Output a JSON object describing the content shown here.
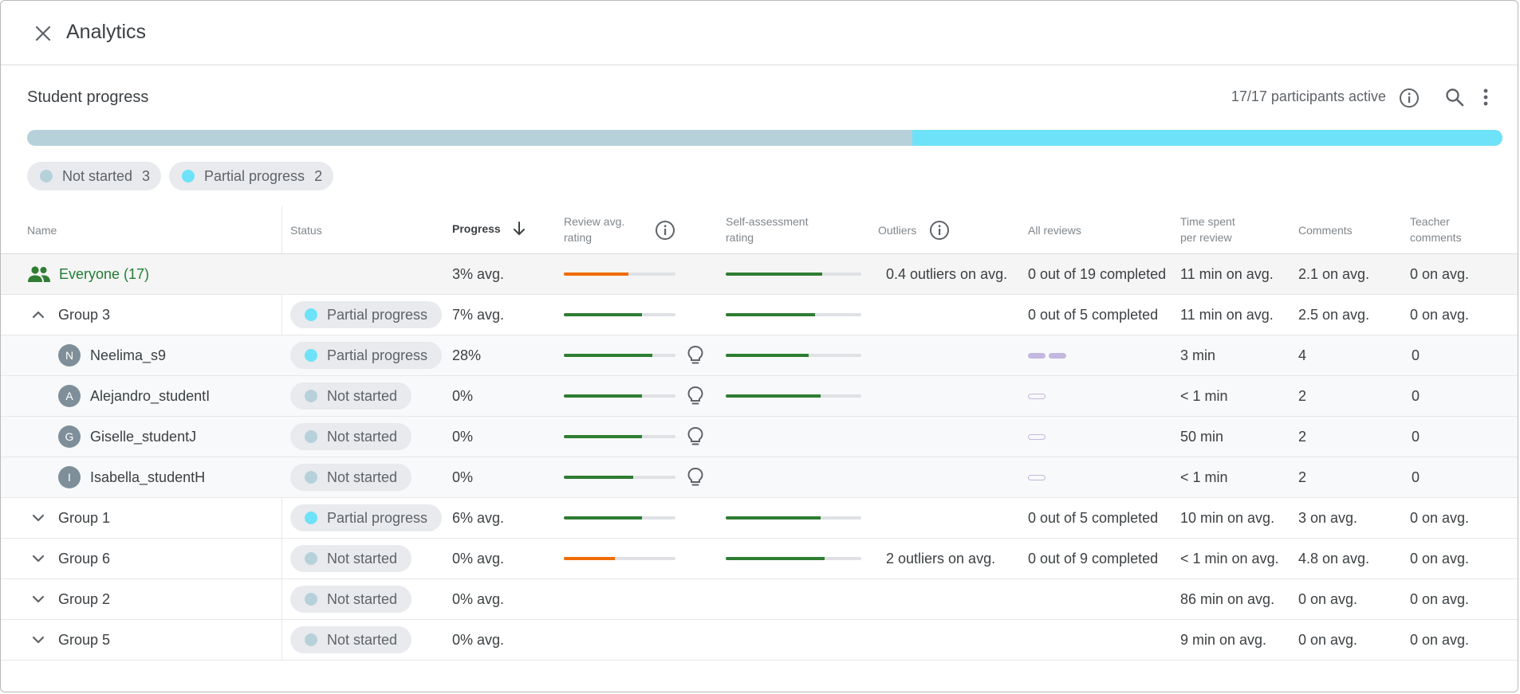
{
  "header": {
    "title": "Analytics"
  },
  "section": {
    "title": "Student progress",
    "participants": "17/17 participants active"
  },
  "overall_progress": {
    "not_started_fraction": 0.6,
    "partial_fraction": 0.4
  },
  "chips": [
    {
      "label": "Not started",
      "count": "3",
      "color": "#b7d1da"
    },
    {
      "label": "Partial progress",
      "count": "2",
      "color": "#6ee2f8"
    }
  ],
  "columns": {
    "name": "Name",
    "status": "Status",
    "progress": "Progress",
    "review_avg_1": "Review avg.",
    "review_avg_2": "rating",
    "self_1": "Self-assessment",
    "self_2": "rating",
    "outliers": "Outliers",
    "all_reviews": "All reviews",
    "time_1": "Time spent",
    "time_2": "per review",
    "comments": "Comments",
    "teacher_1": "Teacher",
    "teacher_2": "comments"
  },
  "colors": {
    "green": "#2e7d32",
    "orange": "#ef6c00",
    "not_started": "#b7d1da",
    "partial": "#6ee2f8"
  },
  "everyone": {
    "name": "Everyone (17)",
    "progress": "3% avg.",
    "review_rating": 0.58,
    "review_color": "orange",
    "self_rating": 0.71,
    "outliers": "0.4 outliers on avg.",
    "all_reviews": "0 out of 19 completed",
    "time": "11 min on avg.",
    "comments": "2.1 on avg.",
    "teacher": "0 on avg."
  },
  "rows": [
    {
      "kind": "group",
      "expanded": true,
      "name": "Group 3",
      "status": "Partial progress",
      "status_key": "partial",
      "progress": "7% avg.",
      "review_rating": 0.7,
      "review_color": "green",
      "self_rating": 0.66,
      "outliers": "",
      "all_reviews": "0 out of 5 completed",
      "time": "11 min on avg.",
      "comments": "2.5 on avg.",
      "teacher": "0 on avg."
    },
    {
      "kind": "student",
      "initial": "N",
      "name": "Neelima_s9",
      "status": "Partial progress",
      "status_key": "partial",
      "progress": "28%",
      "review_rating": 0.79,
      "review_color": "green",
      "bulb": true,
      "self_rating": 0.61,
      "outliers": "",
      "reviews_done": 2,
      "reviews_total": 2,
      "time": "3 min",
      "comments": "4",
      "teacher": "0"
    },
    {
      "kind": "student",
      "initial": "A",
      "name": "Alejandro_studentI",
      "status": "Not started",
      "status_key": "not_started",
      "progress": "0%",
      "review_rating": 0.7,
      "review_color": "green",
      "bulb": true,
      "self_rating": 0.7,
      "outliers": "",
      "reviews_done": 0,
      "reviews_total": 1,
      "time": "< 1 min",
      "comments": "2",
      "teacher": "0"
    },
    {
      "kind": "student",
      "initial": "G",
      "name": "Giselle_studentJ",
      "status": "Not started",
      "status_key": "not_started",
      "progress": "0%",
      "review_rating": 0.7,
      "review_color": "green",
      "bulb": true,
      "self_rating": null,
      "outliers": "",
      "reviews_done": 0,
      "reviews_total": 1,
      "time": "50 min",
      "comments": "2",
      "teacher": "0"
    },
    {
      "kind": "student",
      "initial": "I",
      "name": "Isabella_studentH",
      "status": "Not started",
      "status_key": "not_started",
      "progress": "0%",
      "review_rating": 0.62,
      "review_color": "green",
      "bulb": true,
      "self_rating": null,
      "outliers": "",
      "reviews_done": 0,
      "reviews_total": 1,
      "time": "< 1 min",
      "comments": "2",
      "teacher": "0"
    },
    {
      "kind": "group",
      "expanded": false,
      "name": "Group 1",
      "status": "Partial progress",
      "status_key": "partial",
      "progress": "6% avg.",
      "review_rating": 0.7,
      "review_color": "green",
      "self_rating": 0.7,
      "outliers": "",
      "all_reviews": "0 out of 5 completed",
      "time": "10 min on avg.",
      "comments": "3 on avg.",
      "teacher": "0 on avg."
    },
    {
      "kind": "group",
      "expanded": false,
      "name": "Group 6",
      "status": "Not started",
      "status_key": "not_started",
      "progress": "0% avg.",
      "review_rating": 0.46,
      "review_color": "orange",
      "self_rating": 0.73,
      "outliers": "2 outliers on avg.",
      "all_reviews": "0 out of 9 completed",
      "time": "< 1 min on avg.",
      "comments": "4.8 on avg.",
      "teacher": "0 on avg."
    },
    {
      "kind": "group",
      "expanded": false,
      "name": "Group 2",
      "status": "Not started",
      "status_key": "not_started",
      "progress": "0% avg.",
      "review_rating": null,
      "self_rating": null,
      "outliers": "",
      "all_reviews": "",
      "time": "86 min on avg.",
      "comments": "0 on avg.",
      "teacher": "0 on avg."
    },
    {
      "kind": "group",
      "expanded": false,
      "name": "Group 5",
      "status": "Not started",
      "status_key": "not_started",
      "progress": "0% avg.",
      "review_rating": null,
      "self_rating": null,
      "outliers": "",
      "all_reviews": "",
      "time": "9 min on avg.",
      "comments": "0 on avg.",
      "teacher": "0 on avg."
    }
  ]
}
